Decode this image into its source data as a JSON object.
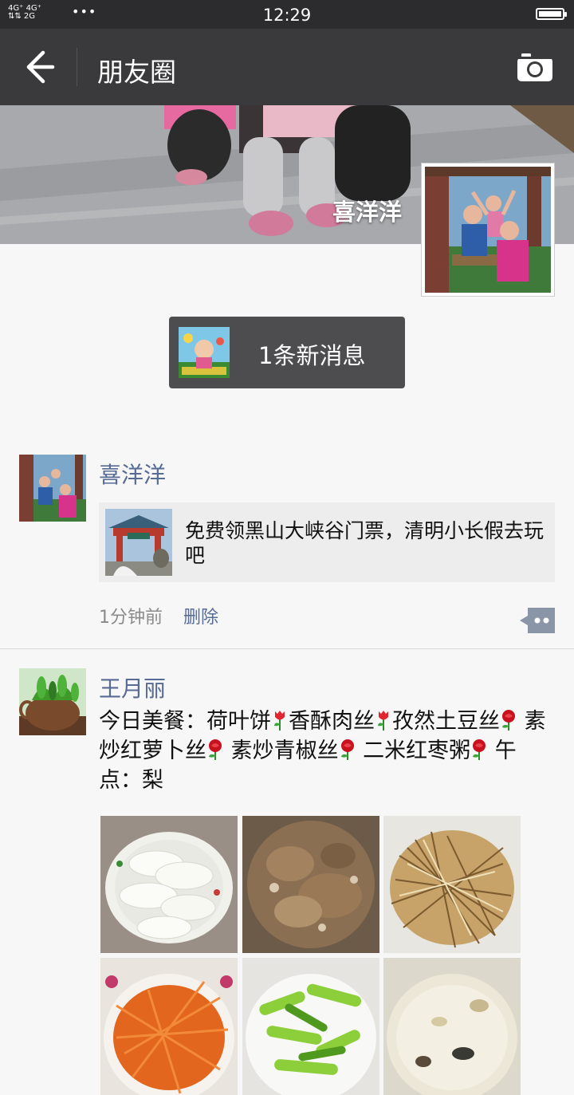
{
  "status_bar": {
    "signal_top": "4G⁺ 4G⁺",
    "signal_bottom": "⇅⇅ 2G",
    "time": "12:29",
    "battery_icon": "battery-full-icon"
  },
  "nav": {
    "title": "朋友圈",
    "back_icon": "back-arrow-icon",
    "camera_icon": "camera-icon"
  },
  "profile": {
    "name": "喜洋洋"
  },
  "new_message": {
    "label": "1条新消息"
  },
  "posts": [
    {
      "author": "喜洋洋",
      "link_title": "免费领黑山大峡谷门票，清明小长假去玩吧",
      "time": "1分钟前",
      "delete_label": "删除"
    },
    {
      "author": "王月丽",
      "text_segments": [
        "今日美餐：荷叶饼",
        "香酥肉丝",
        "孜然土豆丝",
        " 素炒红萝卜丝",
        " 素炒青椒丝",
        " 二米红枣粥",
        " 午点：梨"
      ],
      "photos": [
        "steamed-buns-photo",
        "shredded-pork-photo",
        "potato-strips-photo",
        "carrot-strips-photo",
        "green-pepper-photo",
        "porridge-photo"
      ]
    }
  ],
  "colors": {
    "nav_bg": "#3a3a3c",
    "name_link": "#576b95",
    "page_bg": "#f7f7f7"
  }
}
